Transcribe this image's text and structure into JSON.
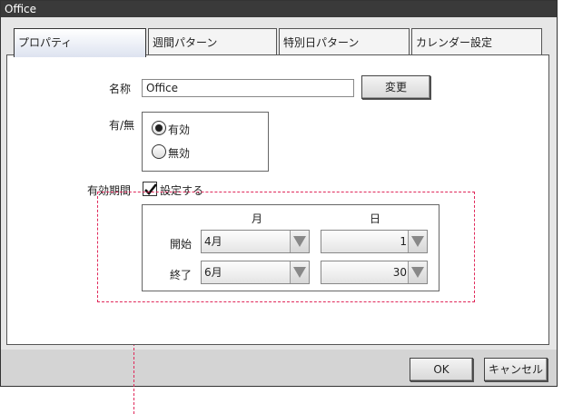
{
  "window": {
    "title": "Office"
  },
  "tabs": [
    {
      "label": "プロパティ",
      "active": true
    },
    {
      "label": "週間パターン",
      "active": false
    },
    {
      "label": "特別日パターン",
      "active": false
    },
    {
      "label": "カレンダー設定",
      "active": false
    }
  ],
  "properties": {
    "name_label": "名称",
    "name_value": "Office",
    "change_button": "変更",
    "enabled_label": "有/無",
    "radio_enabled": "有効",
    "radio_disabled": "無効",
    "selected_option": "有効",
    "period_label": "有効期間",
    "period_checkbox": "設定する",
    "period_checked": true
  },
  "period": {
    "month_header": "月",
    "day_header": "日",
    "start_label": "開始",
    "end_label": "終了",
    "start_month": "4月",
    "start_day": "1",
    "end_month": "6月",
    "end_day": "30"
  },
  "footer": {
    "ok_button": "OK",
    "cancel_button": "キャンセル"
  },
  "colors": {
    "annotation": "#e0285a",
    "titlebar": "#3a3a3a",
    "window_bg": "#e6e6e6"
  }
}
